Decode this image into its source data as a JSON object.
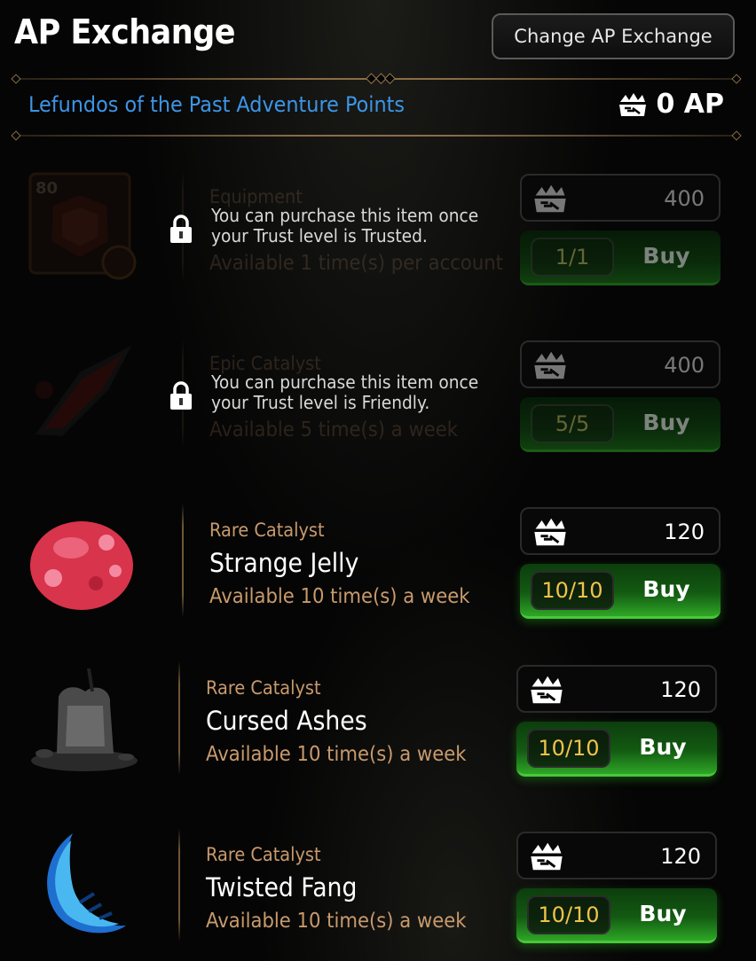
{
  "header": {
    "title": "AP Exchange",
    "change_button": "Change AP Exchange"
  },
  "subheader": {
    "event_name": "Lefundos of the Past Adventure Points",
    "ap_balance": "0 AP",
    "ap_icon": "adventure-points-icon"
  },
  "items": [
    {
      "category": "Equipment",
      "name": "",
      "availability": "Available 1 time(s) per account",
      "level_badge": "80",
      "locked": true,
      "lock_message": "You can purchase this item once your Trust level is Trusted.",
      "price": "400",
      "remaining": "1/1",
      "buy_label": "Buy"
    },
    {
      "category": "Epic Catalyst",
      "name": "",
      "availability": "Available 5 time(s) a week",
      "locked": true,
      "lock_message": "You can purchase this item once your Trust level is Friendly.",
      "price": "400",
      "remaining": "5/5",
      "buy_label": "Buy"
    },
    {
      "category": "Rare Catalyst",
      "name": "Strange Jelly",
      "availability": "Available 10 time(s) a week",
      "locked": false,
      "price": "120",
      "remaining": "10/10",
      "buy_label": "Buy"
    },
    {
      "category": "Rare Catalyst",
      "name": "Cursed Ashes",
      "availability": "Available 10 time(s) a week",
      "locked": false,
      "price": "120",
      "remaining": "10/10",
      "buy_label": "Buy"
    },
    {
      "category": "Rare Catalyst",
      "name": "Twisted Fang",
      "availability": "Available 10 time(s) a week",
      "locked": false,
      "price": "120",
      "remaining": "10/10",
      "buy_label": "Buy"
    }
  ],
  "colors": {
    "accent_blue": "#3d95e6",
    "category_tan": "#c89a6c",
    "buy_green": "#2ea626",
    "count_gold": "#f1c34a"
  }
}
